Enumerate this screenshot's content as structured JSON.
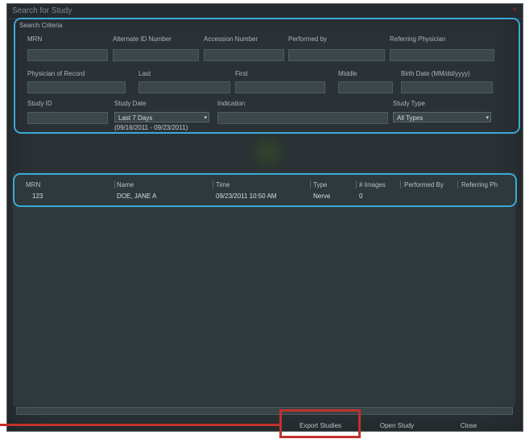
{
  "window": {
    "title": "Search for Study",
    "close_icon": "close-icon"
  },
  "criteria": {
    "heading": "Search Criteria",
    "mrn_label": "MRN",
    "alt_id_label": "Alternate ID Number",
    "accession_label": "Accession Number",
    "performed_by_label": "Performed by",
    "referring_label": "Referring Physician",
    "physician_record_label": "Physician of Record",
    "last_label": "Last",
    "first_label": "First",
    "middle_label": "Middle",
    "birth_date_label": "Birth Date (MM/dd/yyyy)",
    "study_id_label": "Study ID",
    "study_date_label": "Study Date",
    "study_date_value": "Last 7 Days",
    "study_date_range": "(09/16/2011 - 09/23/2011)",
    "indication_label": "Indication",
    "study_type_label": "Study Type",
    "study_type_value": "All Types"
  },
  "results": {
    "columns": [
      "MRN",
      "Name",
      "Time",
      "Type",
      "# Images",
      "Performed By",
      "Referring Ph"
    ],
    "rows": [
      [
        "123",
        "DOE, JANE A",
        "09/23/2011 10:50 AM",
        "Nerve",
        "0",
        "",
        ""
      ]
    ]
  },
  "buttons": {
    "export": "Export Studies",
    "open": "Open Study",
    "close": "Close"
  }
}
